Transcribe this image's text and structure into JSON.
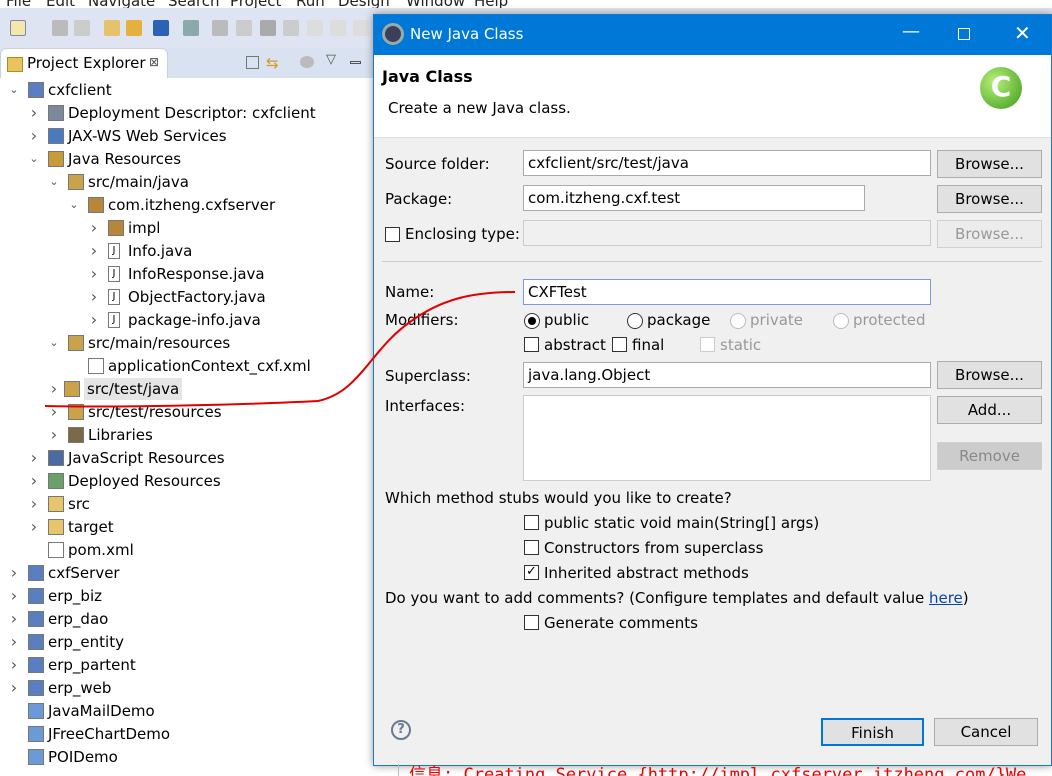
{
  "menu": [
    "File",
    "Edit",
    "Navigate",
    "Search",
    "Project",
    "Run",
    "Design",
    "Window",
    "Help"
  ],
  "explorer": {
    "title": "Project Explorer",
    "close": "⊠",
    "items": [
      {
        "label": "cxfclient",
        "level": 0,
        "arrow": "open",
        "icon": "maven-project-icon"
      },
      {
        "label": "Deployment Descriptor: cxfclient",
        "level": 1,
        "arrow": "closed",
        "icon": "deployment-descriptor-icon"
      },
      {
        "label": "JAX-WS Web Services",
        "level": 1,
        "arrow": "closed",
        "icon": "web-services-icon"
      },
      {
        "label": "Java Resources",
        "level": 1,
        "arrow": "open",
        "icon": "java-resources-icon"
      },
      {
        "label": "src/main/java",
        "level": 2,
        "arrow": "open",
        "icon": "source-folder-icon"
      },
      {
        "label": "com.itzheng.cxfserver",
        "level": 3,
        "arrow": "open",
        "icon": "package-icon"
      },
      {
        "label": "impl",
        "level": 4,
        "arrow": "closed",
        "icon": "package-icon"
      },
      {
        "label": "Info.java",
        "level": 4,
        "arrow": "closed",
        "icon": "java-file-icon"
      },
      {
        "label": "InfoResponse.java",
        "level": 4,
        "arrow": "closed",
        "icon": "java-file-icon"
      },
      {
        "label": "ObjectFactory.java",
        "level": 4,
        "arrow": "closed",
        "icon": "java-file-icon"
      },
      {
        "label": "package-info.java",
        "level": 4,
        "arrow": "closed",
        "icon": "java-file-icon"
      },
      {
        "label": "src/main/resources",
        "level": 2,
        "arrow": "open",
        "icon": "source-folder-icon"
      },
      {
        "label": "applicationContext_cxf.xml",
        "level": 3,
        "arrow": "none",
        "icon": "xml-file-icon"
      },
      {
        "label": "src/test/java",
        "level": 2,
        "arrow": "closed",
        "icon": "source-folder-icon",
        "selected": true
      },
      {
        "label": "src/test/resources",
        "level": 2,
        "arrow": "closed",
        "icon": "source-folder-icon"
      },
      {
        "label": "Libraries",
        "level": 2,
        "arrow": "closed",
        "icon": "libraries-icon"
      },
      {
        "label": "JavaScript Resources",
        "level": 1,
        "arrow": "closed",
        "icon": "javascript-resources-icon"
      },
      {
        "label": "Deployed Resources",
        "level": 1,
        "arrow": "closed",
        "icon": "deployed-resources-icon"
      },
      {
        "label": "src",
        "level": 1,
        "arrow": "closed",
        "icon": "folder-icon"
      },
      {
        "label": "target",
        "level": 1,
        "arrow": "closed",
        "icon": "folder-icon"
      },
      {
        "label": "pom.xml",
        "level": 1,
        "arrow": "none",
        "icon": "pom-file-icon"
      },
      {
        "label": "cxfServer",
        "level": 0,
        "arrow": "closed",
        "icon": "maven-project-icon"
      },
      {
        "label": "erp_biz",
        "level": 0,
        "arrow": "closed",
        "icon": "maven-project-icon"
      },
      {
        "label": "erp_dao",
        "level": 0,
        "arrow": "closed",
        "icon": "maven-project-icon"
      },
      {
        "label": "erp_entity",
        "level": 0,
        "arrow": "closed",
        "icon": "maven-project-icon"
      },
      {
        "label": "erp_partent",
        "level": 0,
        "arrow": "closed",
        "icon": "maven-project-icon"
      },
      {
        "label": "erp_web",
        "level": 0,
        "arrow": "closed",
        "icon": "maven-project-icon"
      },
      {
        "label": "JavaMailDemo",
        "level": 0,
        "arrow": "none",
        "icon": "project-icon"
      },
      {
        "label": "JFreeChartDemo",
        "level": 0,
        "arrow": "none",
        "icon": "project-icon"
      },
      {
        "label": "POIDemo",
        "level": 0,
        "arrow": "none",
        "icon": "project-icon"
      }
    ]
  },
  "dialog": {
    "title": "New Java Class",
    "heading": "Java Class",
    "description": "Create a new Java class.",
    "source_folder_label": "Source folder:",
    "source_folder": "cxfclient/src/test/java",
    "package_label": "Package:",
    "package": "com.itzheng.cxf.test",
    "enclosing_label": "Enclosing type:",
    "enclosing": "",
    "name_label": "Name:",
    "name": "CXFTest",
    "modifiers_label": "Modifiers:",
    "modifiers": {
      "public": "public",
      "package": "package",
      "private": "private",
      "protected": "protected",
      "abstract": "abstract",
      "final": "final",
      "static": "static"
    },
    "superclass_label": "Superclass:",
    "superclass": "java.lang.Object",
    "interfaces_label": "Interfaces:",
    "browse": "Browse...",
    "add": "Add...",
    "remove": "Remove",
    "stubs_question": "Which method stubs would you like to create?",
    "stubs": [
      "public static void main(String[] args)",
      "Constructors from superclass",
      "Inherited abstract methods"
    ],
    "stubs_checked": [
      false,
      false,
      true
    ],
    "comments_question": "Do you want to add comments? (Configure templates and default value ",
    "comments_link": "here",
    "comments_close": ")",
    "generate_comments": "Generate comments",
    "finish": "Finish",
    "cancel": "Cancel",
    "accent": "#0078d7"
  },
  "console": "信息: Creating Service {http://impl.cxfserver.itzheng.com/}We",
  "annotation_color": "#e00000"
}
